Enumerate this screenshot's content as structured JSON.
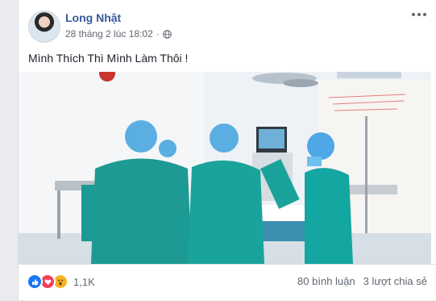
{
  "post": {
    "author": "Long Nhật",
    "timestamp": "28 tháng 2 lúc 18:02",
    "separator": "·",
    "privacy_icon": "globe-icon",
    "text": "Mình Thích Thì Mình Làm Thôi !"
  },
  "footer": {
    "reaction_icons": [
      "like-icon",
      "love-icon",
      "wow-icon"
    ],
    "reaction_count": "1,1K",
    "comments": "80 bình luận",
    "shares": "3 lượt chia sẻ"
  },
  "colors": {
    "author_link": "#385898",
    "scrub": "#1aa39a",
    "cap": "#4fa7e6",
    "like": "#1877f2",
    "love": "#f33e58",
    "wow": "#f7b125"
  }
}
